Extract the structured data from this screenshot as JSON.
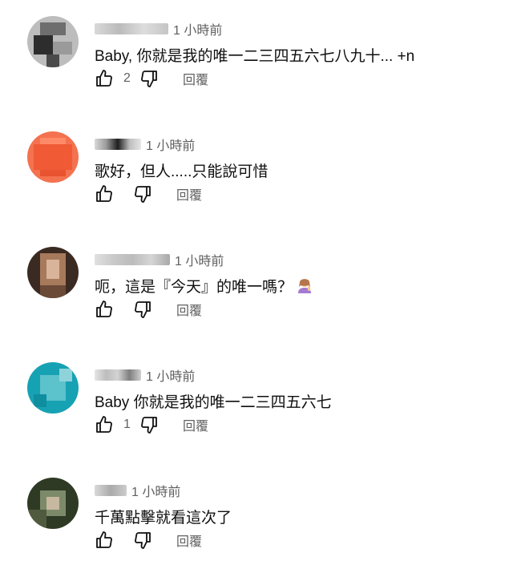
{
  "comments": [
    {
      "author_label": "",
      "time": "1 小時前",
      "text": "Baby, 你就是我的唯一二三四五六七八九十... +n",
      "like_count": "2",
      "reply_label": "回覆",
      "avatar_colors": [
        "#bdbdbd",
        "#6e6e6e",
        "#2d2d2d",
        "#9a9a9a"
      ]
    },
    {
      "author_label": "",
      "time": "1 小時前",
      "text": "歌好，但人.....只能說可惜",
      "like_count": "",
      "reply_label": "回覆",
      "avatar_colors": [
        "#f4724f",
        "#f05a35",
        "#ff8a68",
        "#e8542f"
      ]
    },
    {
      "author_label": "",
      "time": "1 小時前",
      "text": "呃，這是『今天』的唯一嗎？",
      "emoji": "person-raising-hand-emoji",
      "like_count": "",
      "reply_label": "回覆",
      "avatar_colors": [
        "#3a2a22",
        "#a77a5c",
        "#d9b49a",
        "#6b4a38"
      ]
    },
    {
      "author_label": "",
      "time": "1 小時前",
      "text": "Baby 你就是我的唯一二三四五六七",
      "like_count": "1",
      "reply_label": "回覆",
      "avatar_colors": [
        "#17a2b3",
        "#5cc2cc",
        "#0f8ea0",
        "#8fd3da"
      ]
    },
    {
      "author_label": "",
      "time": "1 小時前",
      "text": "千萬點擊就看這次了",
      "like_count": "",
      "reply_label": "回覆",
      "avatar_colors": [
        "#2e3a24",
        "#7d8a6a",
        "#c7b8a0",
        "#4f5a3e"
      ]
    }
  ],
  "colors": {
    "text_primary": "#0f0f0f",
    "text_secondary": "#606060",
    "background": "#ffffff"
  },
  "icons": {
    "like": "thumbs-up-icon",
    "dislike": "thumbs-down-icon"
  }
}
